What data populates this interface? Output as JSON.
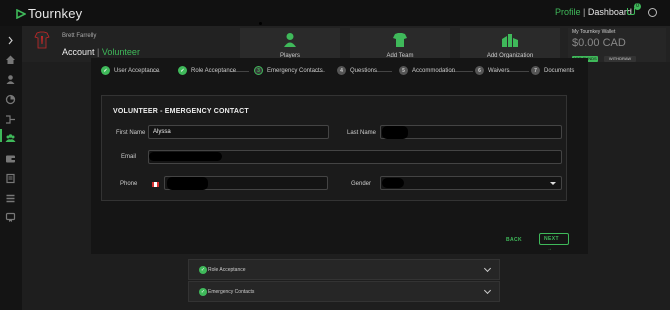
{
  "app": {
    "logo_text": "Tournkey"
  },
  "topnav": {
    "profile": "Profile",
    "separator": "|",
    "dashboard": "Dashboard",
    "cart_count": "0"
  },
  "header": {
    "user_name": "Brett Farrelly",
    "crumb_account": "Account",
    "crumb_sep": "|",
    "crumb_role": "Volunteer",
    "cards": [
      {
        "label": "Players",
        "icon": "person-icon"
      },
      {
        "label": "Add Team",
        "icon": "jersey-icon"
      },
      {
        "label": "Add Organization",
        "icon": "building-icon"
      }
    ],
    "wallet": {
      "title": "My Tournkey Wallet",
      "amount": "$0.00 CAD",
      "add_funds": "ADD FUNDS",
      "withdraw": "WITHDRAW"
    }
  },
  "stepper": [
    {
      "label": "User Acceptance",
      "state": "done",
      "num": ""
    },
    {
      "label": "Role Acceptance",
      "state": "done",
      "num": ""
    },
    {
      "label": "Emergency Contacts",
      "state": "current",
      "num": "3"
    },
    {
      "label": "Questions",
      "state": "pending",
      "num": "4"
    },
    {
      "label": "Accommodation",
      "state": "pending",
      "num": "5"
    },
    {
      "label": "Waivers",
      "state": "pending",
      "num": "6"
    },
    {
      "label": "Documents",
      "state": "pending",
      "num": "7"
    }
  ],
  "form": {
    "title": "VOLUNTEER - EMERGENCY CONTACT",
    "first_name_label": "First Name",
    "first_name_value": "Alyssa",
    "last_name_label": "Last Name",
    "email_label": "Email",
    "phone_label": "Phone",
    "gender_label": "Gender"
  },
  "actions": {
    "back": "BACK",
    "next": "NEXT",
    "next_arrow": "→"
  },
  "accordion": [
    {
      "label": "Role Acceptance"
    },
    {
      "label": "Emergency Contacts"
    }
  ],
  "colors": {
    "accent": "#3fb95a",
    "bg": "#1a1a1a"
  }
}
